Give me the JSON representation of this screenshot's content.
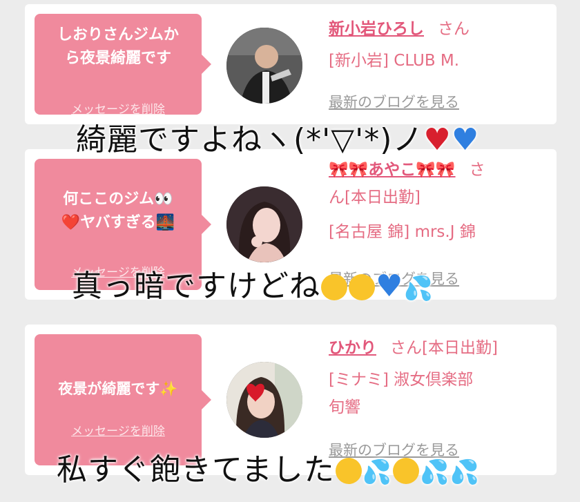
{
  "messages": [
    {
      "bubble_text": "しおりさんジムか\nら夜景綺麗です",
      "delete_label": "メッセージを削除",
      "name": "新小岩ひろし",
      "honorific": "さん",
      "shop": "[新小岩] CLUB M.",
      "blog_link": "最新のブログを見る"
    },
    {
      "bubble_text": "何ここのジム👀\n❤️ヤバすぎる🌉",
      "delete_label": "メッセージを削除",
      "name": "🎀🎀あやこ🎀🎀",
      "honorific": "さ",
      "status_line": "ん[本日出勤]",
      "shop": "[名古屋 錦] mrs.J 錦",
      "blog_link": "最新のブログを見る"
    },
    {
      "bubble_text": "夜景が綺麗です✨",
      "delete_label": "メッセージを削除",
      "name": "ひかり",
      "honorific": "さん[本日出勤]",
      "shop": "[ミナミ] 淑女倶楽部",
      "shop_line2": "旬響",
      "blog_link": "最新のブログを見る"
    }
  ],
  "overlay_captions": [
    {
      "text": "綺麗ですよねヽ(*'▽'*)ノ",
      "emoji": [
        "red-heart",
        "blue-heart"
      ]
    },
    {
      "text": "真っ暗ですけどね",
      "emoji": [
        "tears-of-joy",
        "tears-of-joy",
        "blue-heart",
        "sweat-droplets"
      ]
    },
    {
      "text": "私すぐ飽きてました",
      "emoji": [
        "loudly-crying",
        "sweat-droplets",
        "grinning-sweat",
        "sweat-droplets",
        "sweat-droplets"
      ]
    }
  ],
  "colors": {
    "background": "#ececec",
    "bubble": "#f08a9d",
    "accent_text": "#e56c83",
    "name_text": "#e2577a",
    "muted_link": "#9a9a9a"
  },
  "icons": [
    "red-heart-icon",
    "blue-heart-icon",
    "tears-of-joy-icon",
    "sweat-droplets-icon",
    "loudly-crying-icon",
    "grinning-sweat-icon"
  ]
}
